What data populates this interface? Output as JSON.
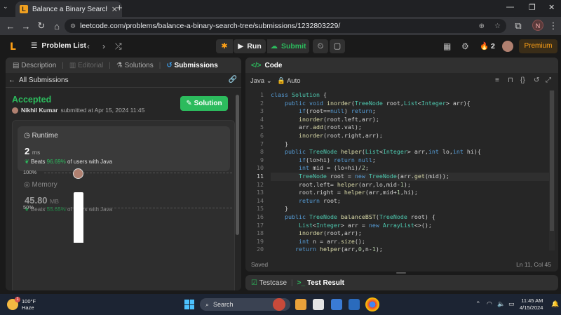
{
  "browser": {
    "tab_title": "Balance a Binary Search Tree - L",
    "url": "leetcode.com/problems/balance-a-binary-search-tree/submissions/1232803229/",
    "profile_initial": "N"
  },
  "header": {
    "problem_list": "Problem List",
    "run_label": "Run",
    "submit_label": "Submit",
    "streak": "2",
    "premium": "Premium"
  },
  "left_tabs": [
    {
      "label": "Description"
    },
    {
      "label": "Editorial"
    },
    {
      "label": "Solutions"
    },
    {
      "label": "Submissions"
    }
  ],
  "submission": {
    "back_label": "All Submissions",
    "status": "Accepted",
    "user": "Nikhil Kumar",
    "submitted_text": "submitted at Apr 15, 2024 11:45",
    "solution_label": "Solution"
  },
  "runtime": {
    "label": "Runtime",
    "value": "2",
    "unit": "ms",
    "beats_prefix": "Beats",
    "beats_pct": "96.69%",
    "beats_suffix": "of users with Java"
  },
  "memory": {
    "label": "Memory",
    "value": "45.80",
    "unit": "MB",
    "beats_prefix": "Beats",
    "beats_pct": "55.65%",
    "beats_suffix": "of users with Java"
  },
  "chart_data": {
    "type": "bar",
    "y_ticks": [
      "100%",
      "50%"
    ],
    "ylim": [
      0,
      100
    ],
    "highlighted_bar_value": 72
  },
  "code_panel": {
    "title": "Code",
    "language": "Java",
    "mode": "Auto",
    "status": "Saved",
    "cursor_position": "Ln 11, Col 45",
    "current_line": 11,
    "lines": [
      "class Solution {",
      "    public void inorder(TreeNode root,List<Integer> arr){",
      "        if(root==null) return;",
      "        inorder(root.left,arr);",
      "        arr.add(root.val);",
      "        inorder(root.right,arr);",
      "    }",
      "    public TreeNode helper(List<Integer> arr,int lo,int hi){",
      "        if(lo>hi) return null;",
      "        int mid = (lo+hi)/2;",
      "        TreeNode root = new TreeNode(arr.get(mid));",
      "        root.left= helper(arr,lo,mid-1);",
      "        root.right = helper(arr,mid+1,hi);",
      "        return root;",
      "    }",
      "    public TreeNode balanceBST(TreeNode root) {",
      "        List<Integer> arr = new ArrayList<>();",
      "        inorder(root,arr);",
      "        int n = arr.size();",
      "       return helper(arr,0,n-1);"
    ]
  },
  "test_panel": {
    "testcase": "Testcase",
    "test_result": "Test Result"
  },
  "taskbar": {
    "temperature": "100°F",
    "condition": "Haze",
    "search": "Search",
    "time": "11:45 AM",
    "date": "4/15/2024"
  }
}
